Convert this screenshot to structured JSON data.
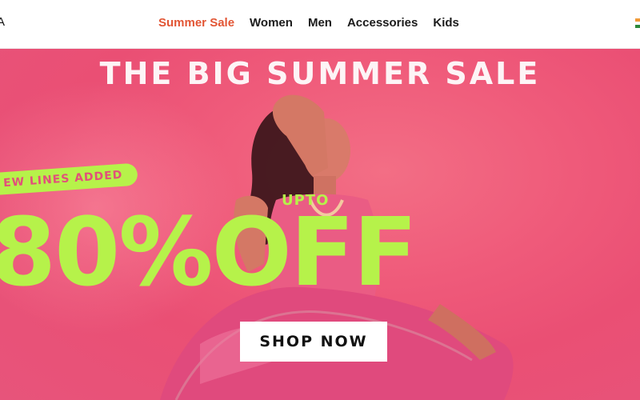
{
  "header": {
    "logo_fragment": "A",
    "nav": [
      {
        "label": "Summer Sale",
        "active": true
      },
      {
        "label": "Women",
        "active": false
      },
      {
        "label": "Men",
        "active": false
      },
      {
        "label": "Accessories",
        "active": false
      },
      {
        "label": "Kids",
        "active": false
      }
    ],
    "country_flag_icon": "india-flag-icon"
  },
  "hero": {
    "title": "THE BIG SUMMER SALE",
    "pill": "EW LINES ADDED",
    "upto": "UPTO",
    "offer": "80%OFF",
    "cta": "SHOP NOW"
  },
  "colors": {
    "accent_nav": "#e25534",
    "hero_pink": "#ef5a7a",
    "lime": "#b6f24a",
    "white": "#ffffff"
  }
}
